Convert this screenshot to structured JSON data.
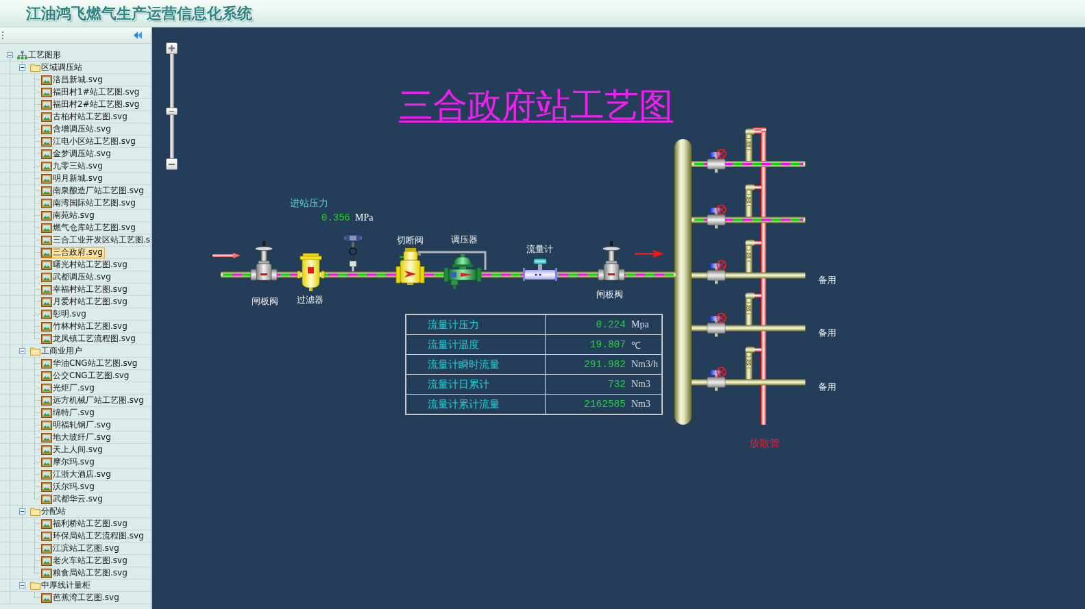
{
  "header": {
    "title": "江油鸿飞燃气生产运营信息化系统"
  },
  "sidebar": {
    "tree": [
      {
        "label": "工艺图形",
        "kind": "root",
        "expanded": true,
        "selected": false,
        "children": [
          {
            "label": "区域调压站",
            "kind": "folder",
            "expanded": true,
            "selected": false,
            "children": [
              {
                "label": "涪昌新城.svg",
                "kind": "file",
                "selected": false
              },
              {
                "label": "福田村1#站工艺图.svg",
                "kind": "file",
                "selected": false
              },
              {
                "label": "福田村2#站工艺图.svg",
                "kind": "file",
                "selected": false
              },
              {
                "label": "古柏村站工艺图.svg",
                "kind": "file",
                "selected": false
              },
              {
                "label": "含增调压站.svg",
                "kind": "file",
                "selected": false
              },
              {
                "label": "江电小区站工艺图.svg",
                "kind": "file",
                "selected": false
              },
              {
                "label": "金梦调压站.svg",
                "kind": "file",
                "selected": false
              },
              {
                "label": "九零三站.svg",
                "kind": "file",
                "selected": false
              },
              {
                "label": "明月新城.svg",
                "kind": "file",
                "selected": false
              },
              {
                "label": "南泉酿造厂站工艺图.svg",
                "kind": "file",
                "selected": false
              },
              {
                "label": "南湾国际站工艺图.svg",
                "kind": "file",
                "selected": false
              },
              {
                "label": "南苑站.svg",
                "kind": "file",
                "selected": false
              },
              {
                "label": "燃气仓库站工艺图.svg",
                "kind": "file",
                "selected": false
              },
              {
                "label": "三合工业开发区站工艺图.s",
                "kind": "file",
                "selected": false
              },
              {
                "label": "三合政府.svg",
                "kind": "file",
                "selected": true
              },
              {
                "label": "曙光村站工艺图.svg",
                "kind": "file",
                "selected": false
              },
              {
                "label": "武都调压站.svg",
                "kind": "file",
                "selected": false
              },
              {
                "label": "幸福村站工艺图.svg",
                "kind": "file",
                "selected": false
              },
              {
                "label": "月爱村站工艺图.svg",
                "kind": "file",
                "selected": false
              },
              {
                "label": "彰明.svg",
                "kind": "file",
                "selected": false
              },
              {
                "label": "竹林村站工艺图.svg",
                "kind": "file",
                "selected": false
              },
              {
                "label": "龙凤镇工艺流程图.svg",
                "kind": "file",
                "selected": false
              }
            ]
          },
          {
            "label": "工商业用户",
            "kind": "folder",
            "expanded": true,
            "selected": false,
            "children": [
              {
                "label": "华油CNG站工艺图.svg",
                "kind": "file",
                "selected": false
              },
              {
                "label": "公交CNG工艺图.svg",
                "kind": "file",
                "selected": false
              },
              {
                "label": "光炬厂.svg",
                "kind": "file",
                "selected": false
              },
              {
                "label": "远方机械厂站工艺图.svg",
                "kind": "file",
                "selected": false
              },
              {
                "label": "绵特厂.svg",
                "kind": "file",
                "selected": false
              },
              {
                "label": "明福轧钢厂.svg",
                "kind": "file",
                "selected": false
              },
              {
                "label": "地大玻纤厂.svg",
                "kind": "file",
                "selected": false
              },
              {
                "label": "天上人间.svg",
                "kind": "file",
                "selected": false
              },
              {
                "label": "摩尔玛.svg",
                "kind": "file",
                "selected": false
              },
              {
                "label": "江浙大酒店.svg",
                "kind": "file",
                "selected": false
              },
              {
                "label": "沃尔玛.svg",
                "kind": "file",
                "selected": false
              },
              {
                "label": "武都华云.svg",
                "kind": "file",
                "selected": false
              }
            ]
          },
          {
            "label": "分配站",
            "kind": "folder",
            "expanded": true,
            "selected": false,
            "children": [
              {
                "label": "福利桥站工艺图.svg",
                "kind": "file",
                "selected": false
              },
              {
                "label": "环保局站工艺流程图.svg",
                "kind": "file",
                "selected": false
              },
              {
                "label": "江滨站工艺图.svg",
                "kind": "file",
                "selected": false
              },
              {
                "label": "老火车站工艺图.svg",
                "kind": "file",
                "selected": false
              },
              {
                "label": "粮食局站工艺图.svg",
                "kind": "file",
                "selected": false
              }
            ]
          },
          {
            "label": "中厚线计量柜",
            "kind": "folder",
            "expanded": true,
            "selected": false,
            "children": [
              {
                "label": "芭蕉湾工艺图.svg",
                "kind": "file",
                "selected": false
              }
            ]
          }
        ]
      }
    ]
  },
  "diagram": {
    "zoom_slider": {
      "level": 0.45
    },
    "title": "三合政府站工艺图",
    "inlet_pressure": {
      "label": "进站压力",
      "value": "0.356",
      "unit": "MPa"
    },
    "main_line": {
      "flowing": true
    },
    "equipment": [
      {
        "kind": "gate_valve",
        "label": "闸板阀"
      },
      {
        "kind": "filter",
        "label": "过滤器"
      },
      {
        "kind": "pressure_transmitter"
      },
      {
        "kind": "shutoff_valve",
        "label": "切断阀"
      },
      {
        "kind": "regulator",
        "label": "调压器"
      },
      {
        "kind": "flow_meter",
        "label": "流量计"
      },
      {
        "kind": "gate_valve",
        "label": "闸板阀"
      }
    ],
    "flow_meter_readings": [
      {
        "label": "流量计压力",
        "value": "0.224",
        "unit": "Mpa"
      },
      {
        "label": "流量计温度",
        "value": "19.807",
        "unit": "℃"
      },
      {
        "label": "流量计瞬时流量",
        "value": "291.982",
        "unit": "Nm3/h"
      },
      {
        "label": "流量计日累计",
        "value": "732",
        "unit": "Nm3"
      },
      {
        "label": "流量计累计流量",
        "value": "2162585",
        "unit": "Nm3"
      }
    ],
    "branches": [
      {
        "flowing": true
      },
      {
        "flowing": true
      },
      {
        "flowing": false,
        "label": "备用"
      },
      {
        "flowing": false,
        "label": "备用"
      },
      {
        "flowing": false,
        "label": "备用"
      }
    ],
    "vent_label": "放散管"
  }
}
